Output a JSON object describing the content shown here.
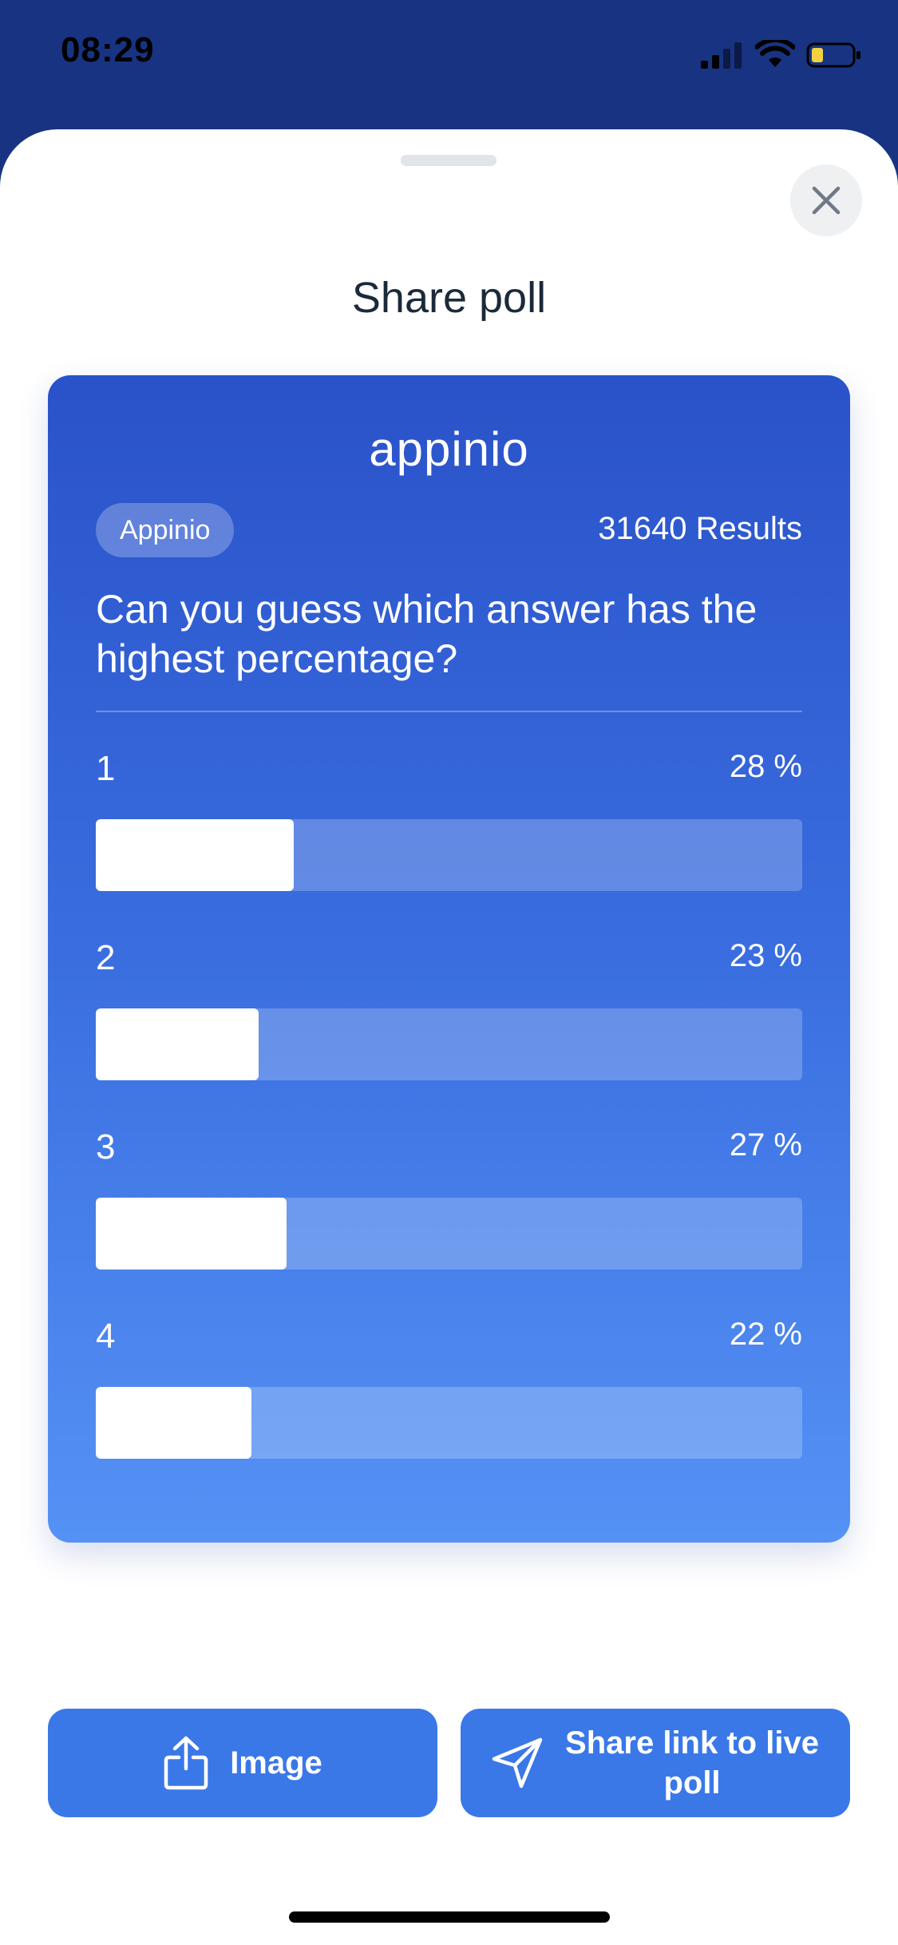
{
  "status_bar": {
    "time": "08:29"
  },
  "sheet": {
    "title": "Share poll"
  },
  "card": {
    "logo": "appinio",
    "tag": "Appinio",
    "results": "31640 Results",
    "question": "Can you guess which answer has the highest percentage?",
    "options": [
      {
        "label": "1",
        "percent_text": "28 %",
        "percent": 28
      },
      {
        "label": "2",
        "percent_text": "23 %",
        "percent": 23
      },
      {
        "label": "3",
        "percent_text": "27 %",
        "percent": 27
      },
      {
        "label": "4",
        "percent_text": "22 %",
        "percent": 22
      }
    ]
  },
  "actions": {
    "image_label": "Image",
    "share_label": "Share link to live poll"
  },
  "colors": {
    "header_bg": "#183382",
    "card_top": "#2a52c9",
    "card_bottom": "#5592f5",
    "button": "#3a78e8"
  },
  "icons": {
    "close": "close-icon",
    "share": "share-upload-icon",
    "send": "paper-plane-icon"
  }
}
